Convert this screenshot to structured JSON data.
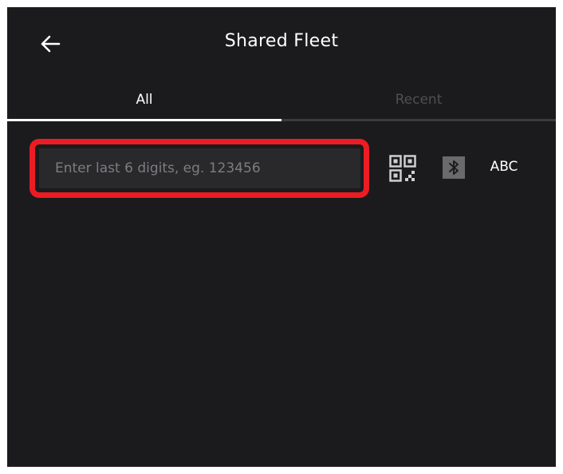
{
  "header": {
    "title": "Shared Fleet",
    "back_icon": "arrow-left-icon"
  },
  "tabs": [
    {
      "label": "All",
      "active": true
    },
    {
      "label": "Recent",
      "active": false
    }
  ],
  "search": {
    "placeholder": "Enter last 6 digits, eg. 123456",
    "value": ""
  },
  "actions": {
    "qr_icon": "qr-code-icon",
    "bluetooth_icon": "bluetooth-icon",
    "abc_label": "ABC"
  },
  "colors": {
    "background": "#1b1b1d",
    "input_background": "#29292c",
    "highlight": "#ec1c24",
    "inactive_tab": "#4f4f52"
  }
}
